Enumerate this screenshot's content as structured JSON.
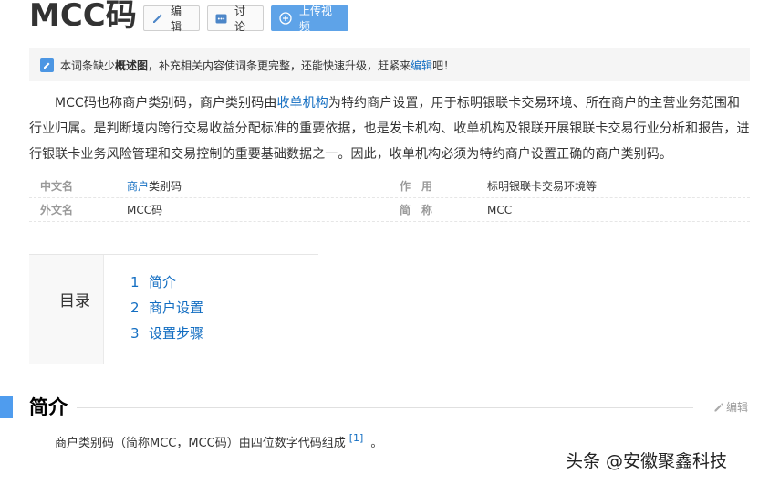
{
  "header": {
    "title": "MCC码",
    "buttons": {
      "edit": "编辑",
      "discuss": "讨论",
      "upload": "上传视频"
    }
  },
  "notice": {
    "prefix": "本词条缺少",
    "bold": "概述图",
    "middle": "，补充相关内容使词条更完整，还能快速升级，赶紧来",
    "link": "编辑",
    "suffix": "吧！"
  },
  "intro": {
    "part1": "MCC码也称商户类别码，商户类别码由",
    "link": "收单机构",
    "part2": "为特约商户设置，用于标明银联卡交易环境、所在商户的主营业务范围和行业归属。是判断境内跨行交易收益分配标准的重要依据，也是发卡机构、收单机构及银联开展银联卡交易行业分析和报告，进行银联卡业务风险管理和交易控制的重要基础数据之一。因此，收单机构必须为特约商户设置正确的商户类别码。"
  },
  "basic_info": {
    "rows": [
      {
        "label1": "中文名",
        "value1_link": "商户",
        "value1_rest": "类别码",
        "label2": "作　用",
        "value2": "标明银联卡交易环境等"
      },
      {
        "label1": "外文名",
        "value1_link": "",
        "value1_rest": "MCC码",
        "label2": "简　称",
        "value2": "MCC"
      }
    ]
  },
  "toc": {
    "title": "目录",
    "items": [
      {
        "num": "1",
        "label": "简介"
      },
      {
        "num": "2",
        "label": "商户设置"
      },
      {
        "num": "3",
        "label": "设置步骤"
      }
    ]
  },
  "section": {
    "title": "简介",
    "edit": "编辑",
    "body": "商户类别码（简称MCC，MCC码）由四位数字代码组成",
    "ref": "[1]",
    "tail": "。"
  },
  "watermark": "头条 @安徽聚鑫科技",
  "colors": {
    "link": "#136ec2",
    "accent": "#4f9cee",
    "upload_button": "#5ea3e8"
  }
}
